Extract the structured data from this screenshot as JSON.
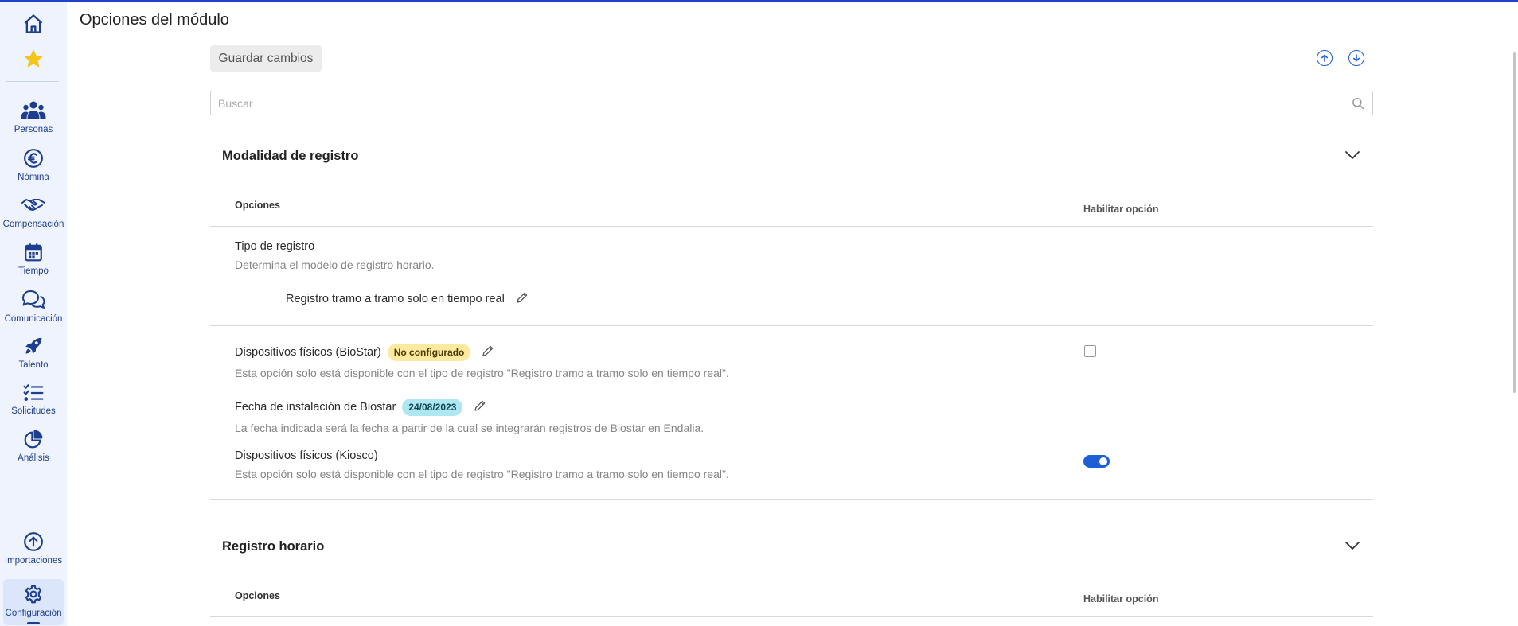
{
  "page": {
    "title": "Opciones del módulo"
  },
  "sidebar": {
    "items": [
      {
        "label": "Personas"
      },
      {
        "label": "Nómina"
      },
      {
        "label": "Compensación"
      },
      {
        "label": "Tiempo"
      },
      {
        "label": "Comunicación"
      },
      {
        "label": "Talento"
      },
      {
        "label": "Solicitudes"
      },
      {
        "label": "Análisis"
      },
      {
        "label": "Importaciones"
      },
      {
        "label": "Configuración"
      }
    ],
    "active_item": "Configuración",
    "favorite_star_color": "#f5c518",
    "accent_color": "#1d3e8e"
  },
  "toolbar": {
    "save_label": "Guardar cambios"
  },
  "search": {
    "placeholder": "Buscar",
    "value": ""
  },
  "sections": [
    {
      "title": "Modalidad de registro",
      "col_options": "Opciones",
      "col_enable": "Habilitar opción",
      "options": [
        {
          "title": "Tipo de registro",
          "description": "Determina el modelo de registro horario.",
          "value": "Registro tramo a tramo solo en tiempo real"
        },
        {
          "title": "Dispositivos físicos (BioStar)",
          "badge": "No configurado",
          "description": "Esta opción solo está disponible con el tipo de registro \"Registro tramo a tramo solo en tiempo real\".",
          "enabled": false
        },
        {
          "title": "Fecha de instalación de Biostar",
          "badge": "24/08/2023",
          "description": "La fecha indicada será la fecha a partir de la cual se integrarán registros de Biostar en Endalia."
        },
        {
          "title": "Dispositivos físicos (Kiosco)",
          "description": "Esta opción solo está disponible con el tipo de registro \"Registro tramo a tramo solo en tiempo real\".",
          "enabled": true
        }
      ]
    },
    {
      "title": "Registro horario",
      "col_options": "Opciones",
      "col_enable": "Habilitar opción"
    }
  ],
  "colors": {
    "primary": "#1e5fd6",
    "badge_warning": "#fdeaa0",
    "badge_date": "#aee7ef"
  }
}
